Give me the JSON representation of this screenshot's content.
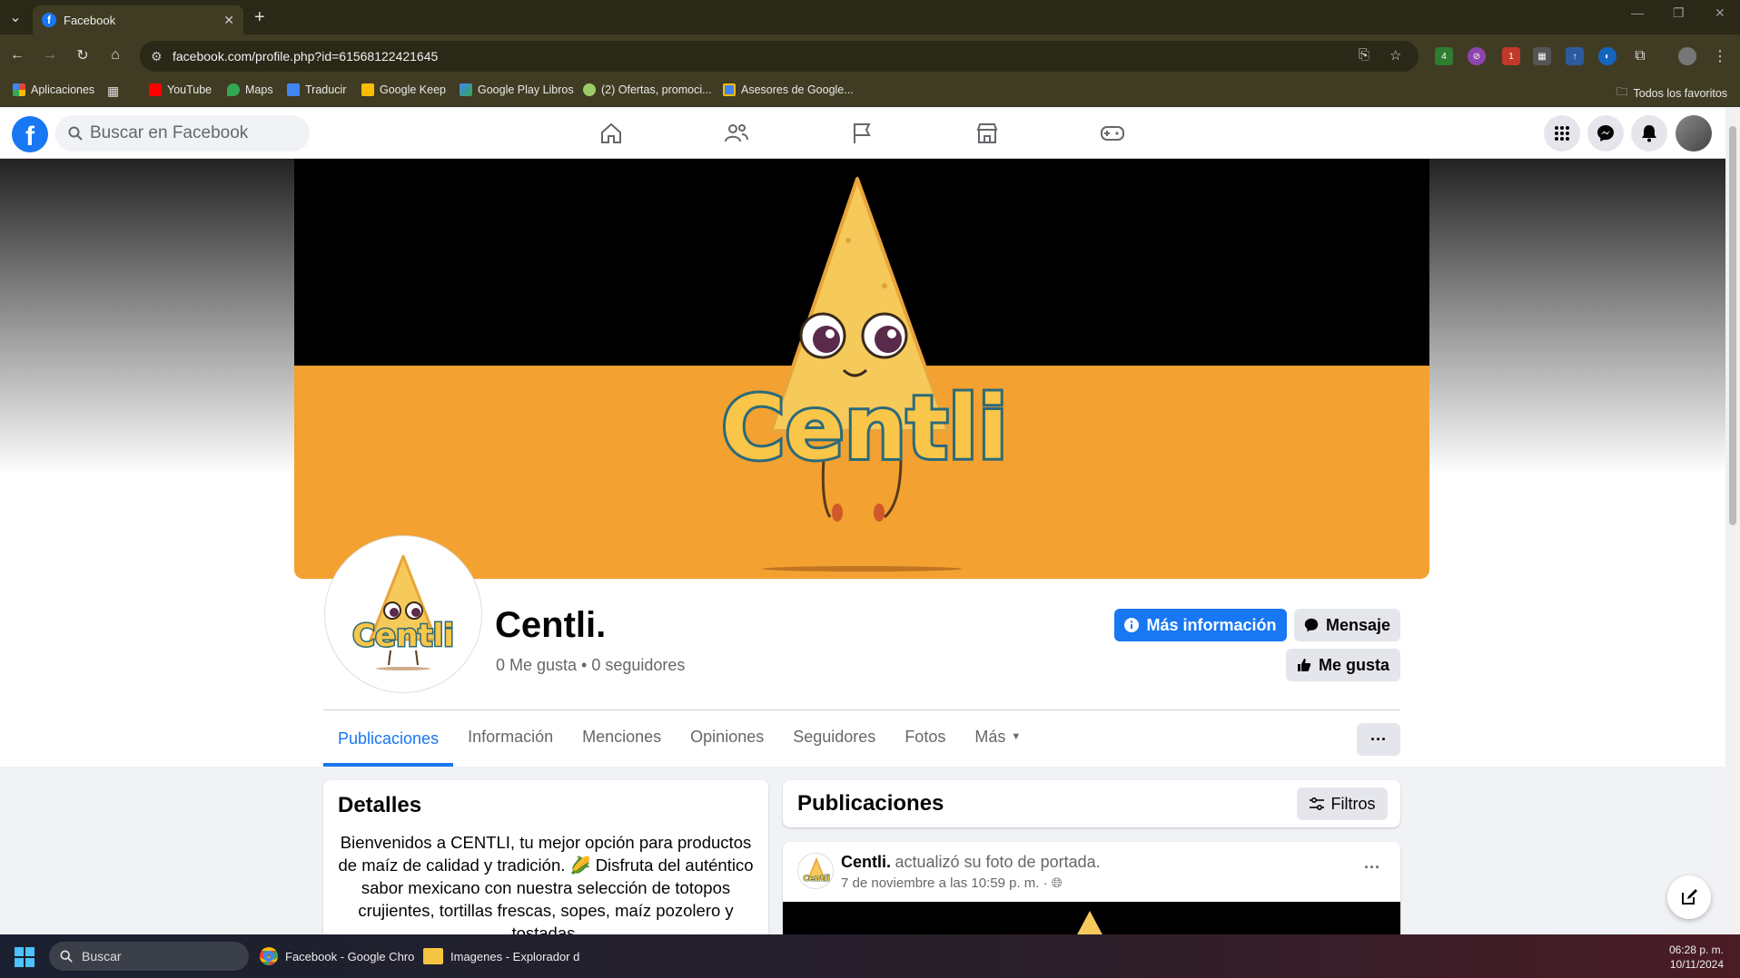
{
  "browser": {
    "tab_title": "Facebook",
    "url": "facebook.com/profile.php?id=61568122421645",
    "bookmarks": [
      "Aplicaciones",
      "YouTube",
      "Maps",
      "Traducir",
      "Google Keep",
      "Google Play Libros",
      "(2) Ofertas, promoci...",
      "Asesores de Google..."
    ],
    "all_bookmarks": "Todos los favoritos"
  },
  "fb_header": {
    "search_placeholder": "Buscar en Facebook"
  },
  "profile": {
    "name": "Centli.",
    "stats": "0 Me gusta • 0 seguidores",
    "btn_info": "Más información",
    "btn_message": "Mensaje",
    "btn_like": "Me gusta",
    "cover_text": "Centli",
    "tabs": [
      "Publicaciones",
      "Información",
      "Menciones",
      "Opiniones",
      "Seguidores",
      "Fotos",
      "Más"
    ],
    "more": "···"
  },
  "details": {
    "title": "Detalles",
    "text": "Bienvenidos a CENTLI, tu mejor opción para productos de maíz de calidad y tradición. 🌽 Disfruta del auténtico sabor mexicano con nuestra selección de totopos crujientes, tortillas frescas, sopes, maíz pozolero y tostadas."
  },
  "posts": {
    "title": "Publicaciones",
    "filters": "Filtros",
    "post": {
      "author": "Centli.",
      "action": "actualizó su foto de portada.",
      "time": "7 de noviembre a las 10:59 p. m. ·",
      "menu": "···"
    }
  },
  "taskbar": {
    "search": "Buscar",
    "app1": "Facebook - Google Chro",
    "app2": "Imagenes - Explorador d",
    "time": "06:28 p. m.",
    "date": "10/11/2024"
  }
}
